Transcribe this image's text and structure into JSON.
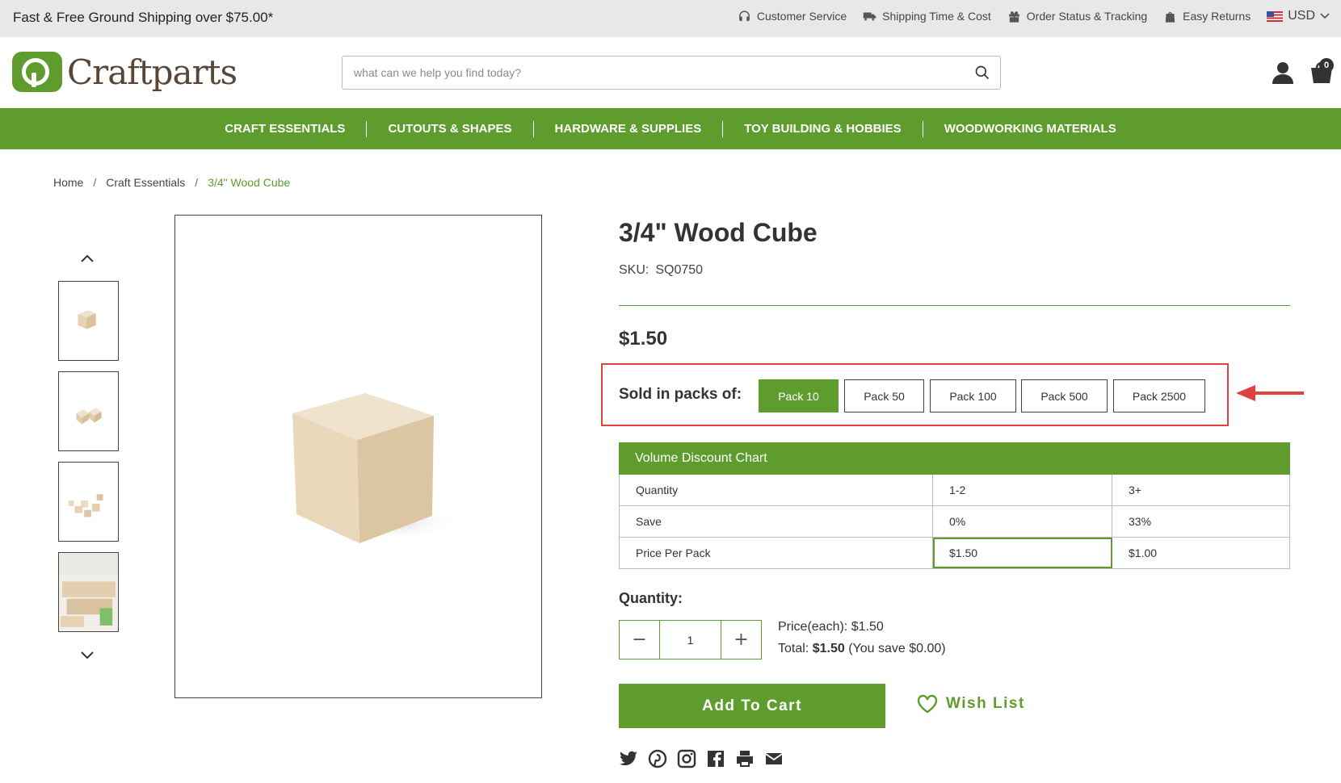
{
  "topbar": {
    "promo": "Fast & Free Ground Shipping over $75.00*",
    "links": [
      {
        "label": "Customer Service",
        "icon": "headset-icon"
      },
      {
        "label": "Shipping Time & Cost",
        "icon": "truck-icon"
      },
      {
        "label": "Order Status & Tracking",
        "icon": "gift-icon"
      },
      {
        "label": "Easy Returns",
        "icon": "return-bag-icon"
      }
    ],
    "currency": "USD"
  },
  "header": {
    "logo_text": "Craftparts",
    "search_placeholder": "what can we help you find today?",
    "cart_count": "0"
  },
  "nav": {
    "items": [
      "CRAFT ESSENTIALS",
      "CUTOUTS & SHAPES",
      "HARDWARE & SUPPLIES",
      "TOY BUILDING & HOBBIES",
      "WOODWORKING MATERIALS"
    ]
  },
  "breadcrumb": {
    "items": [
      "Home",
      "Craft Essentials",
      "3/4\" Wood Cube"
    ],
    "separator": "/"
  },
  "product": {
    "title": "3/4\" Wood Cube",
    "sku_label": "SKU:",
    "sku": "SQ0750",
    "price": "$1.50",
    "packs_label": "Sold in packs of:",
    "packs": [
      "Pack 10",
      "Pack 50",
      "Pack 100",
      "Pack 500",
      "Pack 2500"
    ],
    "selected_pack": "Pack 10"
  },
  "volume_chart": {
    "title": "Volume Discount Chart",
    "rows": [
      [
        "Quantity",
        "1-2",
        "3+"
      ],
      [
        "Save",
        "0%",
        "33%"
      ],
      [
        "Price Per Pack",
        "$1.50",
        "$1.00"
      ]
    ]
  },
  "purchase": {
    "quantity_label": "Quantity:",
    "quantity": "1",
    "price_each_label": "Price(each):",
    "price_each": "$1.50",
    "total_label": "Total:",
    "total": "$1.50",
    "savings": "(You save $0.00)",
    "add_to_cart": "Add To Cart",
    "wishlist": "Wish List"
  },
  "colors": {
    "brand_green": "#5d9c2d",
    "highlight_red": "#e0433f"
  }
}
